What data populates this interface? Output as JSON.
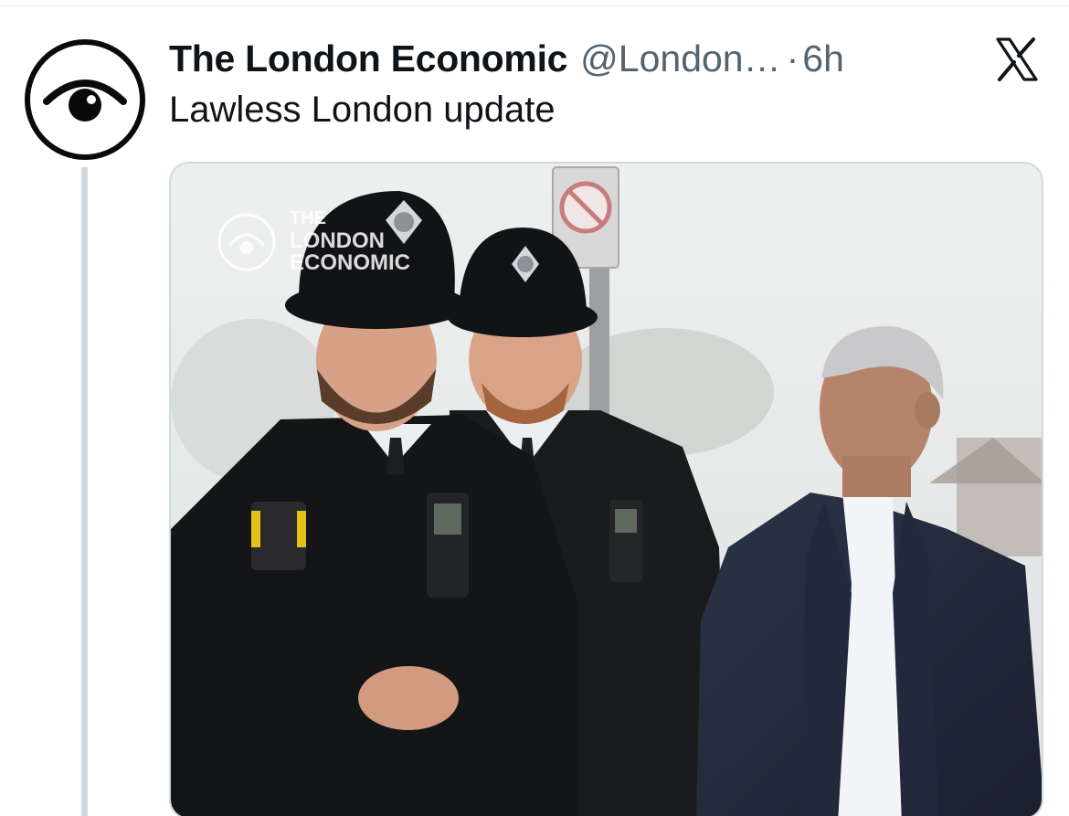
{
  "tweet": {
    "display_name": "The London Economic",
    "handle": "@London…",
    "separator": "·",
    "timestamp": "6h",
    "text": "Lawless London update",
    "avatar_icon": "eye-logo-icon",
    "platform_icon": "x-logo-icon"
  },
  "media": {
    "watermark_line1": "THE",
    "watermark_line2": "LONDON",
    "watermark_line3": "ECONOMIC",
    "watermark_icon": "eye-logo-icon"
  },
  "colors": {
    "text_primary": "#0f1419",
    "text_secondary": "#536471",
    "border": "#cfd9de",
    "background": "#ffffff"
  }
}
